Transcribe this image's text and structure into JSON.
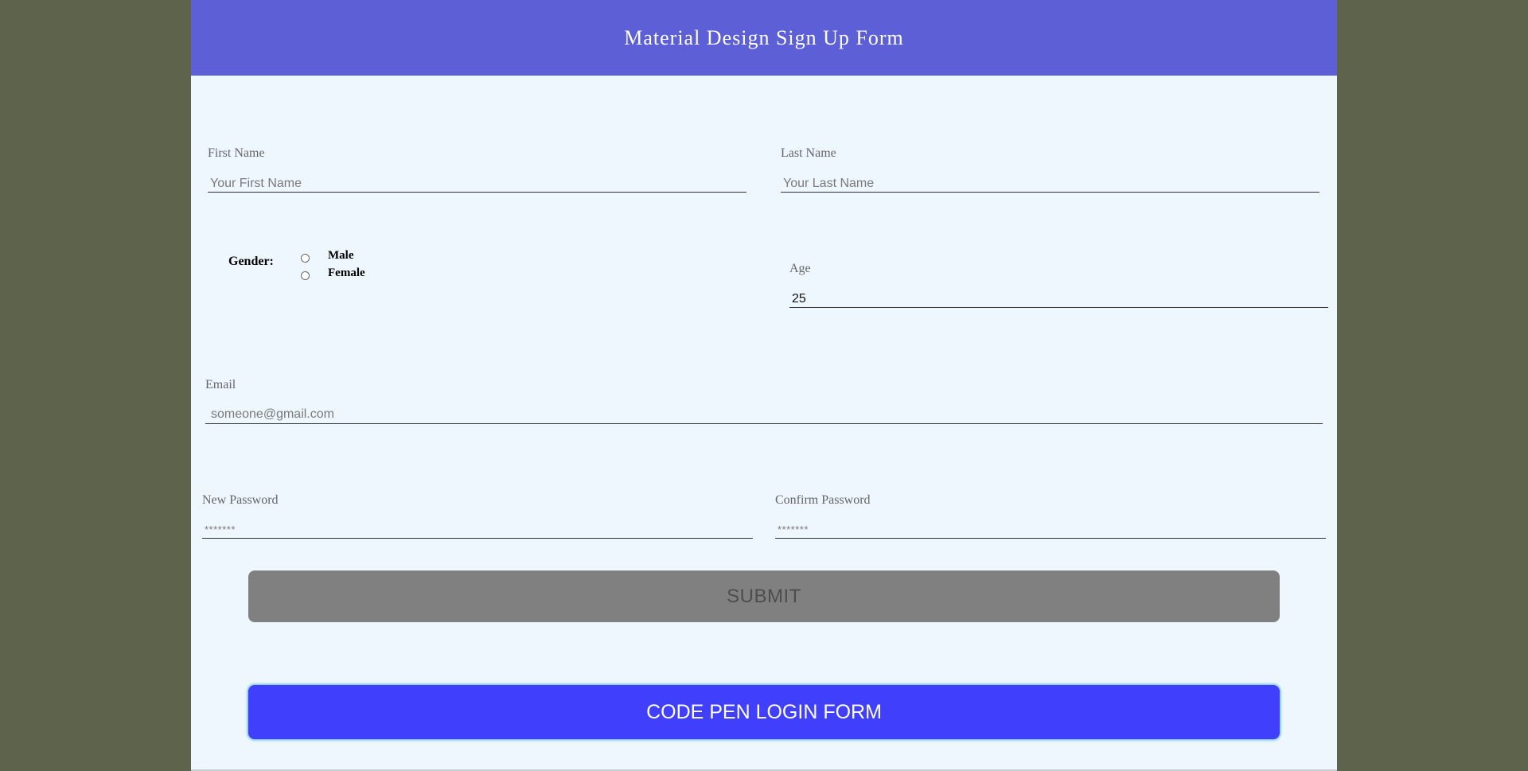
{
  "header": {
    "title": "Material Design Sign Up Form"
  },
  "form": {
    "first_name": {
      "label": "First Name",
      "placeholder": "Your First Name",
      "value": ""
    },
    "last_name": {
      "label": "Last Name",
      "placeholder": "Your Last Name",
      "value": ""
    },
    "gender": {
      "label": "Gender:",
      "options": [
        "Male",
        "Female"
      ],
      "selected": ""
    },
    "age": {
      "label": "Age",
      "value": "25"
    },
    "email": {
      "label": "Email",
      "placeholder": "someone@gmail.com",
      "value": ""
    },
    "new_password": {
      "label": "New Password",
      "placeholder": "*******",
      "value": ""
    },
    "confirm_password": {
      "label": "Confirm Password",
      "placeholder": "*******",
      "value": ""
    },
    "submit_label": "SUBMIT"
  },
  "codepen_button": {
    "label": "CODE PEN LOGIN FORM"
  },
  "colors": {
    "background": "#5d644b",
    "header": "#5c5fd6",
    "form_bg": "#eef6fe",
    "submit": "#808080",
    "codepen_button": "#3f3ffc"
  }
}
